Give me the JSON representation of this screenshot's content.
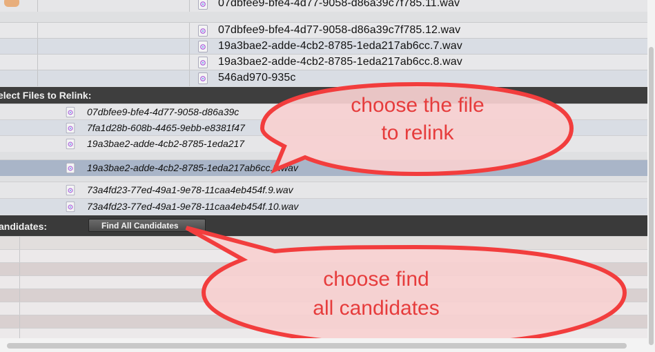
{
  "top_files": [
    {
      "name": "07dbfee9-bfe4-4d77-9058-d86a39c7f785.11.wav"
    },
    {
      "name": "07dbfee9-bfe4-4d77-9058-d86a39c7f785.12.wav"
    },
    {
      "name": "19a3bae2-adde-4cb2-8785-1eda217ab6cc.7.wav"
    },
    {
      "name": "19a3bae2-adde-4cb2-8785-1eda217ab6cc.8.wav"
    },
    {
      "name": "546ad970-935c"
    }
  ],
  "select_section": {
    "title": "elect Files to Relink:",
    "files": [
      {
        "name": "07dbfee9-bfe4-4d77-9058-d86a39c"
      },
      {
        "name": "7fa1d28b-608b-4465-9ebb-e8381f47"
      },
      {
        "name": "19a3bae2-adde-4cb2-8785-1eda217"
      },
      {
        "name": "19a3bae2-adde-4cb2-8785-1eda217ab6cc.8.wav"
      },
      {
        "name": "73a4fd23-77ed-49a1-9e78-11caa4eb454f.9.wav"
      },
      {
        "name": "73a4fd23-77ed-49a1-9e78-11caa4eb454f.10.wav"
      }
    ],
    "selected_index": 3
  },
  "candidates_section": {
    "label": "andidates:",
    "find_button_label": "Find All Candidates"
  },
  "annotations": [
    {
      "line1": "choose the file",
      "line2": "to relink"
    },
    {
      "line1": "choose find",
      "line2": "all candidates"
    }
  ],
  "colors": {
    "callout_text": "#e63c3c",
    "callout_stroke": "#f23d3d",
    "callout_fill": "#f7d0d0",
    "header_bg": "#3e3e3e",
    "selected_row": "#a9b5c8"
  }
}
